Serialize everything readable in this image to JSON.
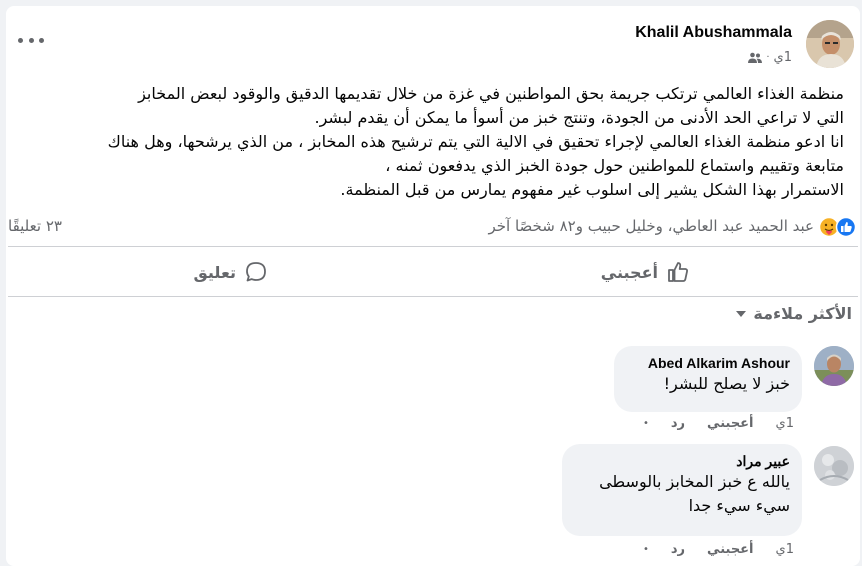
{
  "post": {
    "author": "Khalil Abushammala",
    "time": "1ي",
    "audience_icon": "friends-icon",
    "text_lines": [
      "منظمة الغذاء العالمي ترتكب جريمة بحق المواطنين في غزة من خلال تقديمها الدقيق والوقود لبعض  المخابز",
      "التي لا تراعي الحد الأدنى من الجودة، وتنتج خبز من أسوأ ما يمكن أن يقدم لبشر.",
      "انا ادعو منظمة الغذاء العالمي لإجراء تحقيق في الالية التي يتم ترشيح هذه المخابز ، من الذي يرشحها، وهل هناك",
      "متابعة وتقييم واستماع للمواطنين حول جودة الخبز الذي يدفعون ثمنه ،",
      "الاستمرار بهذا الشكل يشير إلى اسلوب غير مفهوم يمارس من قبل المنظمة."
    ],
    "reactions": {
      "icons": [
        "like-reaction-icon",
        "care-reaction-icon"
      ],
      "names": "عبد الحميد عبد العاطي، وخليل حبيب و٨٢ شخصًا آخر",
      "comment_count": "٢٣ تعليقًا"
    },
    "actions": {
      "like": "أعجبني",
      "comment": "تعليق"
    }
  },
  "sort": {
    "label": "الأكثر ملاءمة"
  },
  "comments": [
    {
      "author": "Abed Alkarim Ashour",
      "text": "خبز لا يصلح للبشر!",
      "time": "1ي",
      "like": "أعجبني",
      "reply": "رد"
    },
    {
      "author": "عبير مراد",
      "text_lines": [
        "يالله ع خبز المخابز بالوسطى",
        "سيء سيء جدا"
      ],
      "time": "1ي",
      "like": "أعجبني",
      "reply": "رد"
    }
  ],
  "colors": {
    "like_blue": "#1877f2",
    "care_yellow": "#f7b125",
    "muted": "#65676b"
  }
}
